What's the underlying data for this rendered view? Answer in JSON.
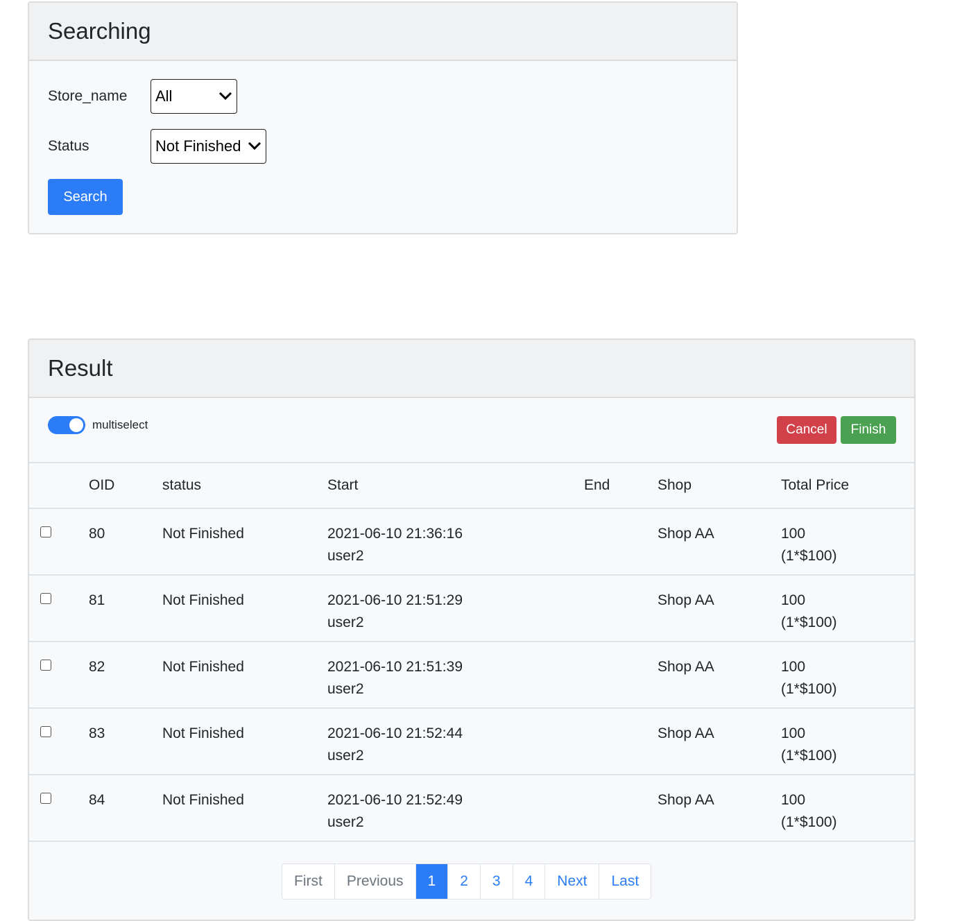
{
  "search": {
    "title": "Searching",
    "store_label": "Store_name",
    "store_value": "All",
    "status_label": "Status",
    "status_value": "Not Finished",
    "button": "Search"
  },
  "result": {
    "title": "Result",
    "toggle_label": "multiselect",
    "cancel": "Cancel",
    "finish": "Finish",
    "columns": [
      "",
      "OID",
      "status",
      "Start",
      "End",
      "Shop",
      "Total Price"
    ],
    "rows": [
      {
        "oid": "80",
        "status": "Not Finished",
        "start": "2021-06-10 21:36:16",
        "user": "user2",
        "end": "",
        "shop": "Shop AA",
        "total": "100",
        "detail": "(1*$100)"
      },
      {
        "oid": "81",
        "status": "Not Finished",
        "start": "2021-06-10 21:51:29",
        "user": "user2",
        "end": "",
        "shop": "Shop AA",
        "total": "100",
        "detail": "(1*$100)"
      },
      {
        "oid": "82",
        "status": "Not Finished",
        "start": "2021-06-10 21:51:39",
        "user": "user2",
        "end": "",
        "shop": "Shop AA",
        "total": "100",
        "detail": "(1*$100)"
      },
      {
        "oid": "83",
        "status": "Not Finished",
        "start": "2021-06-10 21:52:44",
        "user": "user2",
        "end": "",
        "shop": "Shop AA",
        "total": "100",
        "detail": "(1*$100)"
      },
      {
        "oid": "84",
        "status": "Not Finished",
        "start": "2021-06-10 21:52:49",
        "user": "user2",
        "end": "",
        "shop": "Shop AA",
        "total": "100",
        "detail": "(1*$100)"
      }
    ],
    "pagination": [
      "First",
      "Previous",
      "1",
      "2",
      "3",
      "4",
      "Next",
      "Last"
    ],
    "active_page": "1"
  },
  "colors": {
    "primary": "#2b7cf6",
    "danger": "#d2404a",
    "success": "#4aa152"
  }
}
